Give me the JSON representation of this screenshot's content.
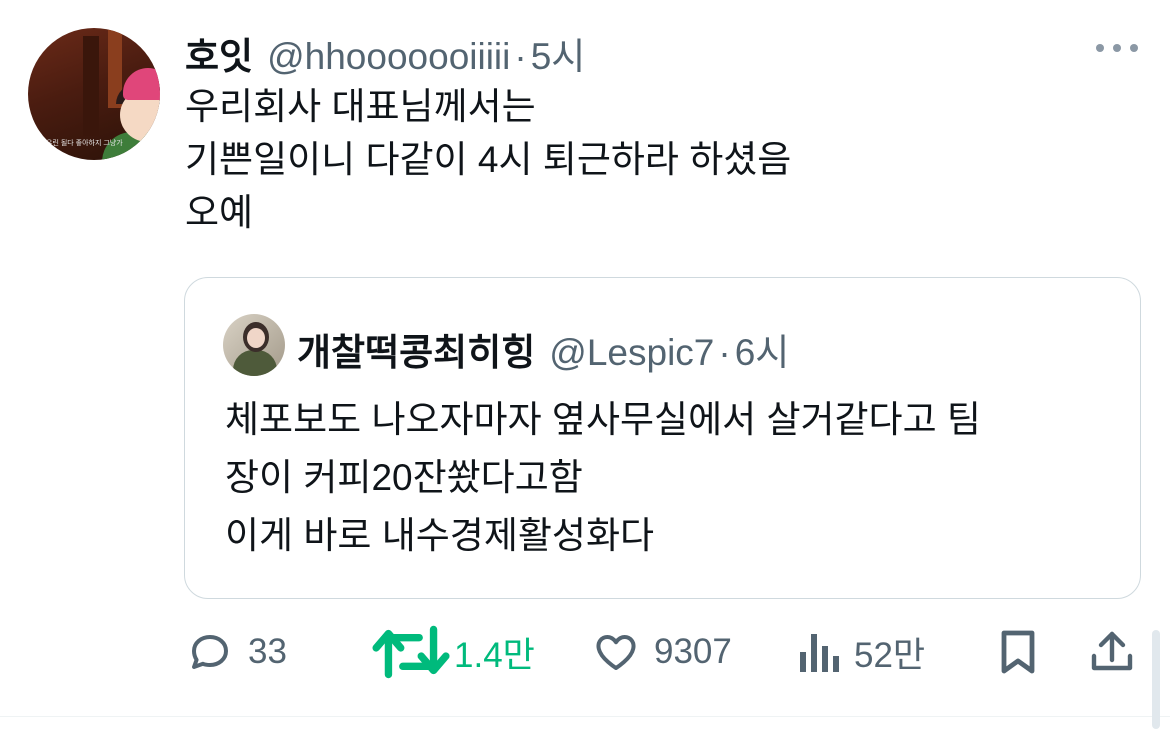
{
  "tweet": {
    "author_name": "호잇",
    "author_handle": "@hhooooooiiiii",
    "separator": "·",
    "time": "5시",
    "lines": [
      "우리회사 대표님께서는",
      "기쁜일이니 다같이 4시 퇴근하라 하셨음",
      "오예"
    ],
    "avatar_caption": "우린 될다 좋아하지 그냥가"
  },
  "quote": {
    "author_name": "개찰떡콩최히힝",
    "author_handle": "@Lespic7",
    "separator": "·",
    "time": "6시",
    "lines": [
      "체포보도 나오자마자 옆사무실에서 살거같다고 팀",
      "장이 커피20잔쐈다고함",
      "이게 바로 내수경제활성화다"
    ]
  },
  "actions": {
    "reply_count": "33",
    "retweet_count": "1.4만",
    "like_count": "9307",
    "views_count": "52만"
  },
  "icons": {
    "more": "more-horizontal-icon",
    "reply": "reply-icon",
    "retweet": "retweet-icon",
    "like": "heart-icon",
    "views": "views-chart-icon",
    "bookmark": "bookmark-icon",
    "share": "share-icon"
  },
  "colors": {
    "text_primary": "#0f1419",
    "text_secondary": "#536471",
    "retweet_active": "#00ba7c",
    "border": "#cfd9de"
  }
}
